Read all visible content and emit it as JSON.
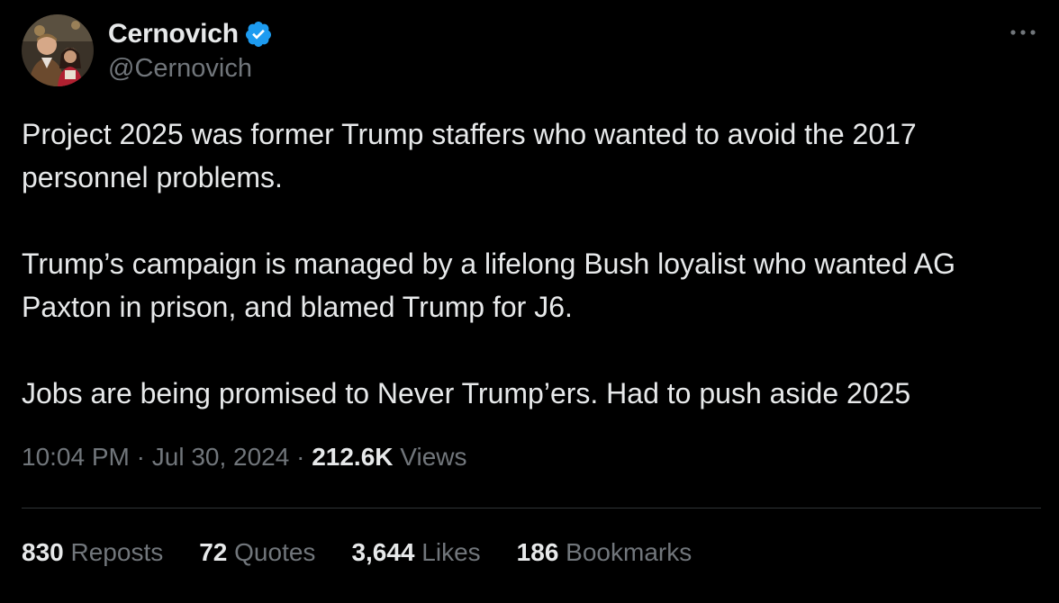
{
  "author": {
    "display_name": "Cernovich",
    "handle": "@Cernovich",
    "verified": true,
    "avatar_icon": "profile-photo"
  },
  "more_icon": "more-horizontal-icon",
  "tweet": {
    "paragraphs": [
      {
        "line1": "Project 2025 was former Trump staffers who wanted to avoid the 2017",
        "line2": "personnel problems."
      },
      {
        "line1": "Trump’s campaign is managed by a lifelong Bush loyalist who wanted AG",
        "line2": "Paxton in prison, and blamed Trump for J6."
      },
      {
        "line1": "Jobs are being promised to Never Trump’ers. Had to push aside 2025"
      }
    ]
  },
  "meta": {
    "time": "10:04 PM",
    "separator": "·",
    "date": "Jul 30, 2024",
    "views_count": "212.6K",
    "views_label": "Views"
  },
  "stats": {
    "reposts": {
      "count": "830",
      "label": "Reposts"
    },
    "quotes": {
      "count": "72",
      "label": "Quotes"
    },
    "likes": {
      "count": "3,644",
      "label": "Likes"
    },
    "bookmarks": {
      "count": "186",
      "label": "Bookmarks"
    }
  },
  "colors": {
    "background": "#000000",
    "text_primary": "#e7e9ea",
    "text_secondary": "#71767b",
    "verified_blue": "#1d9bf0",
    "divider": "#2f3336"
  }
}
